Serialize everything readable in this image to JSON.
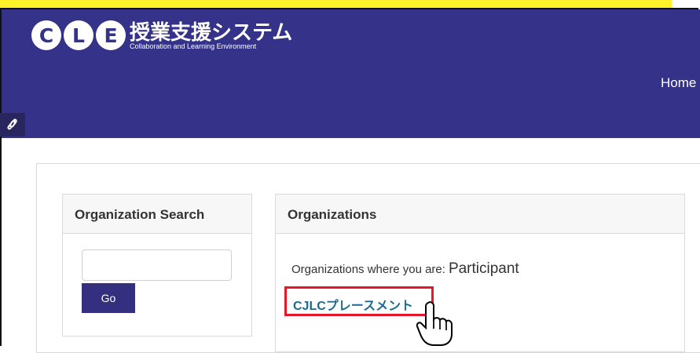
{
  "header": {
    "logo_letters": [
      "C",
      "L",
      "E"
    ],
    "logo_title": "授業支援システム",
    "logo_subtitle": "Collaboration and Learning Environment",
    "nav_home": "Home"
  },
  "sidebar_toggle_icon": "link-icon",
  "search_panel": {
    "title": "Organization Search",
    "input_value": "",
    "go_label": "Go"
  },
  "organizations_panel": {
    "title": "Organizations",
    "membership_text": "Organizations where you are:",
    "membership_role": "Participant",
    "org_link_label": "CJLCプレースメント"
  },
  "colors": {
    "header": "#353289",
    "button": "#34307f",
    "highlight": "#e7162a",
    "link": "#1f6a8f",
    "top_band": "#fff22a"
  }
}
